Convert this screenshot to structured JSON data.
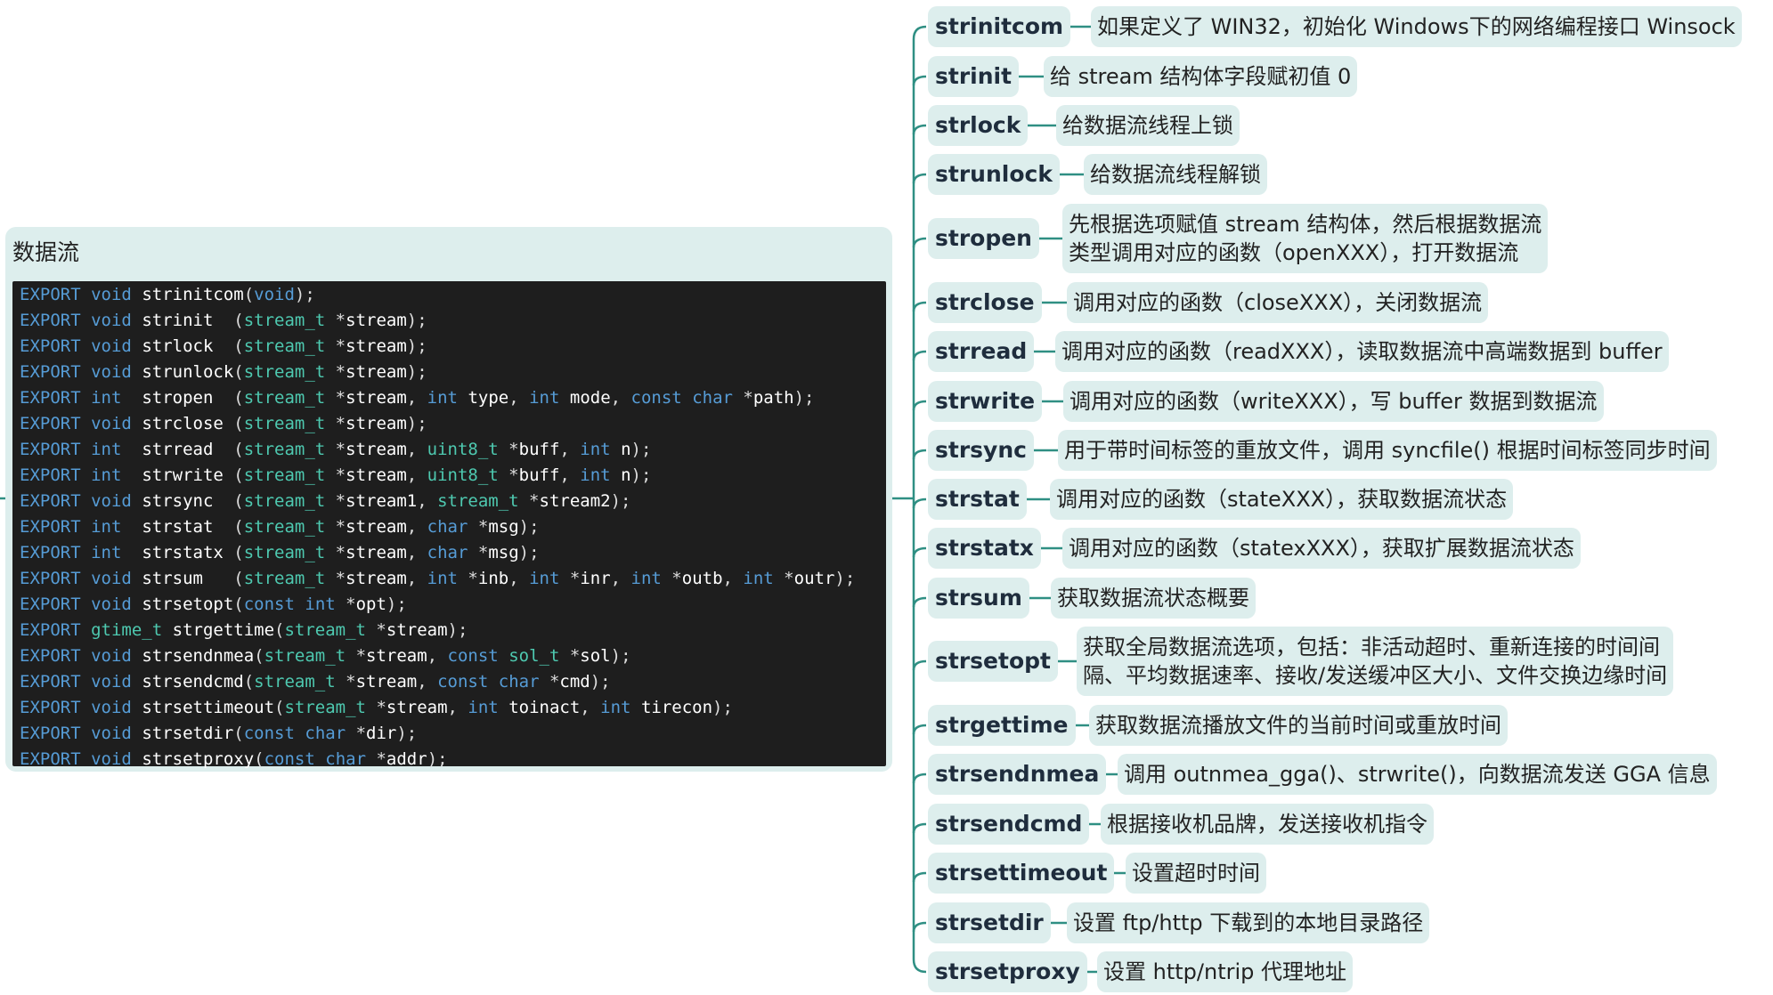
{
  "panel": {
    "title": "数据流"
  },
  "code_lines": [
    [
      [
        "kw",
        "EXPORT"
      ],
      [
        "pu",
        " "
      ],
      [
        "kw",
        "void"
      ],
      [
        "pu",
        " "
      ],
      [
        "fn",
        "strinitcom"
      ],
      [
        "pu",
        "("
      ],
      [
        "kw",
        "void"
      ],
      [
        "pu",
        ");"
      ]
    ],
    [
      [
        "kw",
        "EXPORT"
      ],
      [
        "pu",
        " "
      ],
      [
        "kw",
        "void"
      ],
      [
        "pu",
        " "
      ],
      [
        "fn",
        "strinit  "
      ],
      [
        "pu",
        "("
      ],
      [
        "ty",
        "stream_t"
      ],
      [
        "pu",
        " *"
      ],
      [
        "pm",
        "stream"
      ],
      [
        "pu",
        ");"
      ]
    ],
    [
      [
        "kw",
        "EXPORT"
      ],
      [
        "pu",
        " "
      ],
      [
        "kw",
        "void"
      ],
      [
        "pu",
        " "
      ],
      [
        "fn",
        "strlock  "
      ],
      [
        "pu",
        "("
      ],
      [
        "ty",
        "stream_t"
      ],
      [
        "pu",
        " *"
      ],
      [
        "pm",
        "stream"
      ],
      [
        "pu",
        ");"
      ]
    ],
    [
      [
        "kw",
        "EXPORT"
      ],
      [
        "pu",
        " "
      ],
      [
        "kw",
        "void"
      ],
      [
        "pu",
        " "
      ],
      [
        "fn",
        "strunlock"
      ],
      [
        "pu",
        "("
      ],
      [
        "ty",
        "stream_t"
      ],
      [
        "pu",
        " *"
      ],
      [
        "pm",
        "stream"
      ],
      [
        "pu",
        ");"
      ]
    ],
    [
      [
        "kw",
        "EXPORT"
      ],
      [
        "pu",
        " "
      ],
      [
        "kw",
        "int "
      ],
      [
        "pu",
        " "
      ],
      [
        "fn",
        "stropen  "
      ],
      [
        "pu",
        "("
      ],
      [
        "ty",
        "stream_t"
      ],
      [
        "pu",
        " *"
      ],
      [
        "pm",
        "stream"
      ],
      [
        "pu",
        ", "
      ],
      [
        "kw",
        "int"
      ],
      [
        "pu",
        " "
      ],
      [
        "pm",
        "type"
      ],
      [
        "pu",
        ", "
      ],
      [
        "kw",
        "int"
      ],
      [
        "pu",
        " "
      ],
      [
        "pm",
        "mode"
      ],
      [
        "pu",
        ", "
      ],
      [
        "kw",
        "const"
      ],
      [
        "pu",
        " "
      ],
      [
        "kw",
        "char"
      ],
      [
        "pu",
        " *"
      ],
      [
        "pm",
        "path"
      ],
      [
        "pu",
        ");"
      ]
    ],
    [
      [
        "kw",
        "EXPORT"
      ],
      [
        "pu",
        " "
      ],
      [
        "kw",
        "void"
      ],
      [
        "pu",
        " "
      ],
      [
        "fn",
        "strclose "
      ],
      [
        "pu",
        "("
      ],
      [
        "ty",
        "stream_t"
      ],
      [
        "pu",
        " *"
      ],
      [
        "pm",
        "stream"
      ],
      [
        "pu",
        ");"
      ]
    ],
    [
      [
        "kw",
        "EXPORT"
      ],
      [
        "pu",
        " "
      ],
      [
        "kw",
        "int "
      ],
      [
        "pu",
        " "
      ],
      [
        "fn",
        "strread  "
      ],
      [
        "pu",
        "("
      ],
      [
        "ty",
        "stream_t"
      ],
      [
        "pu",
        " *"
      ],
      [
        "pm",
        "stream"
      ],
      [
        "pu",
        ", "
      ],
      [
        "ty",
        "uint8_t"
      ],
      [
        "pu",
        " *"
      ],
      [
        "pm",
        "buff"
      ],
      [
        "pu",
        ", "
      ],
      [
        "kw",
        "int"
      ],
      [
        "pu",
        " "
      ],
      [
        "pm",
        "n"
      ],
      [
        "pu",
        ");"
      ]
    ],
    [
      [
        "kw",
        "EXPORT"
      ],
      [
        "pu",
        " "
      ],
      [
        "kw",
        "int "
      ],
      [
        "pu",
        " "
      ],
      [
        "fn",
        "strwrite "
      ],
      [
        "pu",
        "("
      ],
      [
        "ty",
        "stream_t"
      ],
      [
        "pu",
        " *"
      ],
      [
        "pm",
        "stream"
      ],
      [
        "pu",
        ", "
      ],
      [
        "ty",
        "uint8_t"
      ],
      [
        "pu",
        " *"
      ],
      [
        "pm",
        "buff"
      ],
      [
        "pu",
        ", "
      ],
      [
        "kw",
        "int"
      ],
      [
        "pu",
        " "
      ],
      [
        "pm",
        "n"
      ],
      [
        "pu",
        ");"
      ]
    ],
    [
      [
        "kw",
        "EXPORT"
      ],
      [
        "pu",
        " "
      ],
      [
        "kw",
        "void"
      ],
      [
        "pu",
        " "
      ],
      [
        "fn",
        "strsync  "
      ],
      [
        "pu",
        "("
      ],
      [
        "ty",
        "stream_t"
      ],
      [
        "pu",
        " *"
      ],
      [
        "pm",
        "stream1"
      ],
      [
        "pu",
        ", "
      ],
      [
        "ty",
        "stream_t"
      ],
      [
        "pu",
        " *"
      ],
      [
        "pm",
        "stream2"
      ],
      [
        "pu",
        ");"
      ]
    ],
    [
      [
        "kw",
        "EXPORT"
      ],
      [
        "pu",
        " "
      ],
      [
        "kw",
        "int "
      ],
      [
        "pu",
        " "
      ],
      [
        "fn",
        "strstat  "
      ],
      [
        "pu",
        "("
      ],
      [
        "ty",
        "stream_t"
      ],
      [
        "pu",
        " *"
      ],
      [
        "pm",
        "stream"
      ],
      [
        "pu",
        ", "
      ],
      [
        "kw",
        "char"
      ],
      [
        "pu",
        " *"
      ],
      [
        "pm",
        "msg"
      ],
      [
        "pu",
        ");"
      ]
    ],
    [
      [
        "kw",
        "EXPORT"
      ],
      [
        "pu",
        " "
      ],
      [
        "kw",
        "int "
      ],
      [
        "pu",
        " "
      ],
      [
        "fn",
        "strstatx "
      ],
      [
        "pu",
        "("
      ],
      [
        "ty",
        "stream_t"
      ],
      [
        "pu",
        " *"
      ],
      [
        "pm",
        "stream"
      ],
      [
        "pu",
        ", "
      ],
      [
        "kw",
        "char"
      ],
      [
        "pu",
        " *"
      ],
      [
        "pm",
        "msg"
      ],
      [
        "pu",
        ");"
      ]
    ],
    [
      [
        "kw",
        "EXPORT"
      ],
      [
        "pu",
        " "
      ],
      [
        "kw",
        "void"
      ],
      [
        "pu",
        " "
      ],
      [
        "fn",
        "strsum   "
      ],
      [
        "pu",
        "("
      ],
      [
        "ty",
        "stream_t"
      ],
      [
        "pu",
        " *"
      ],
      [
        "pm",
        "stream"
      ],
      [
        "pu",
        ", "
      ],
      [
        "kw",
        "int"
      ],
      [
        "pu",
        " *"
      ],
      [
        "pm",
        "inb"
      ],
      [
        "pu",
        ", "
      ],
      [
        "kw",
        "int"
      ],
      [
        "pu",
        " *"
      ],
      [
        "pm",
        "inr"
      ],
      [
        "pu",
        ", "
      ],
      [
        "kw",
        "int"
      ],
      [
        "pu",
        " *"
      ],
      [
        "pm",
        "outb"
      ],
      [
        "pu",
        ", "
      ],
      [
        "kw",
        "int"
      ],
      [
        "pu",
        " *"
      ],
      [
        "pm",
        "outr"
      ],
      [
        "pu",
        ");"
      ]
    ],
    [
      [
        "kw",
        "EXPORT"
      ],
      [
        "pu",
        " "
      ],
      [
        "kw",
        "void"
      ],
      [
        "pu",
        " "
      ],
      [
        "fn",
        "strsetopt"
      ],
      [
        "pu",
        "("
      ],
      [
        "kw",
        "const"
      ],
      [
        "pu",
        " "
      ],
      [
        "kw",
        "int"
      ],
      [
        "pu",
        " *"
      ],
      [
        "pm",
        "opt"
      ],
      [
        "pu",
        ");"
      ]
    ],
    [
      [
        "kw",
        "EXPORT"
      ],
      [
        "pu",
        " "
      ],
      [
        "ty",
        "gtime_t"
      ],
      [
        "pu",
        " "
      ],
      [
        "fn",
        "strgettime"
      ],
      [
        "pu",
        "("
      ],
      [
        "ty",
        "stream_t"
      ],
      [
        "pu",
        " *"
      ],
      [
        "pm",
        "stream"
      ],
      [
        "pu",
        ");"
      ]
    ],
    [
      [
        "kw",
        "EXPORT"
      ],
      [
        "pu",
        " "
      ],
      [
        "kw",
        "void"
      ],
      [
        "pu",
        " "
      ],
      [
        "fn",
        "strsendnmea"
      ],
      [
        "pu",
        "("
      ],
      [
        "ty",
        "stream_t"
      ],
      [
        "pu",
        " *"
      ],
      [
        "pm",
        "stream"
      ],
      [
        "pu",
        ", "
      ],
      [
        "kw",
        "const"
      ],
      [
        "pu",
        " "
      ],
      [
        "ty",
        "sol_t"
      ],
      [
        "pu",
        " *"
      ],
      [
        "pm",
        "sol"
      ],
      [
        "pu",
        ");"
      ]
    ],
    [
      [
        "kw",
        "EXPORT"
      ],
      [
        "pu",
        " "
      ],
      [
        "kw",
        "void"
      ],
      [
        "pu",
        " "
      ],
      [
        "fn",
        "strsendcmd"
      ],
      [
        "pu",
        "("
      ],
      [
        "ty",
        "stream_t"
      ],
      [
        "pu",
        " *"
      ],
      [
        "pm",
        "stream"
      ],
      [
        "pu",
        ", "
      ],
      [
        "kw",
        "const"
      ],
      [
        "pu",
        " "
      ],
      [
        "kw",
        "char"
      ],
      [
        "pu",
        " *"
      ],
      [
        "pm",
        "cmd"
      ],
      [
        "pu",
        ");"
      ]
    ],
    [
      [
        "kw",
        "EXPORT"
      ],
      [
        "pu",
        " "
      ],
      [
        "kw",
        "void"
      ],
      [
        "pu",
        " "
      ],
      [
        "fn",
        "strsettimeout"
      ],
      [
        "pu",
        "("
      ],
      [
        "ty",
        "stream_t"
      ],
      [
        "pu",
        " *"
      ],
      [
        "pm",
        "stream"
      ],
      [
        "pu",
        ", "
      ],
      [
        "kw",
        "int"
      ],
      [
        "pu",
        " "
      ],
      [
        "pm",
        "toinact"
      ],
      [
        "pu",
        ", "
      ],
      [
        "kw",
        "int"
      ],
      [
        "pu",
        " "
      ],
      [
        "pm",
        "tirecon"
      ],
      [
        "pu",
        ");"
      ]
    ],
    [
      [
        "kw",
        "EXPORT"
      ],
      [
        "pu",
        " "
      ],
      [
        "kw",
        "void"
      ],
      [
        "pu",
        " "
      ],
      [
        "fn",
        "strsetdir"
      ],
      [
        "pu",
        "("
      ],
      [
        "kw",
        "const"
      ],
      [
        "pu",
        " "
      ],
      [
        "kw",
        "char"
      ],
      [
        "pu",
        " *"
      ],
      [
        "pm",
        "dir"
      ],
      [
        "pu",
        ");"
      ]
    ],
    [
      [
        "kw",
        "EXPORT"
      ],
      [
        "pu",
        " "
      ],
      [
        "kw",
        "void"
      ],
      [
        "pu",
        " "
      ],
      [
        "fn",
        "strsetproxy"
      ],
      [
        "pu",
        "("
      ],
      [
        "kw",
        "const"
      ],
      [
        "pu",
        " "
      ],
      [
        "kw",
        "char"
      ],
      [
        "pu",
        " *"
      ],
      [
        "pm",
        "addr"
      ],
      [
        "pu",
        ");"
      ]
    ]
  ],
  "nodes": [
    {
      "name": "strinitcom",
      "desc": [
        "如果定义了 WIN32，初始化 Windows下的网络编程接口 Winsock"
      ]
    },
    {
      "name": "strinit",
      "desc": [
        "给 stream 结构体字段赋初值 0"
      ]
    },
    {
      "name": "strlock",
      "desc": [
        "给数据流线程上锁"
      ]
    },
    {
      "name": "strunlock",
      "desc": [
        "给数据流线程解锁"
      ]
    },
    {
      "name": "stropen",
      "desc": [
        "先根据选项赋值 stream 结构体，然后根据数据流",
        "类型调用对应的函数（openXXX），打开数据流"
      ]
    },
    {
      "name": "strclose",
      "desc": [
        "调用对应的函数（closeXXX），关闭数据流"
      ]
    },
    {
      "name": "strread",
      "desc": [
        "调用对应的函数（readXXX），读取数据流中高端数据到 buffer"
      ]
    },
    {
      "name": "strwrite",
      "desc": [
        "调用对应的函数（writeXXX），写 buffer 数据到数据流"
      ]
    },
    {
      "name": "strsync",
      "desc": [
        "用于带时间标签的重放文件，调用 syncfile() 根据时间标签同步时间"
      ]
    },
    {
      "name": "strstat",
      "desc": [
        "调用对应的函数（stateXXX），获取数据流状态"
      ]
    },
    {
      "name": "strstatx",
      "desc": [
        "调用对应的函数（statexXXX），获取扩展数据流状态"
      ]
    },
    {
      "name": "strsum",
      "desc": [
        "获取数据流状态概要"
      ]
    },
    {
      "name": "strsetopt",
      "desc": [
        "获取全局数据流选项，包括：非活动超时、重新连接的时间间",
        "隔、平均数据速率、接收/发送缓冲区大小、文件交换边缘时间"
      ]
    },
    {
      "name": "strgettime",
      "desc": [
        "获取数据流播放文件的当前时间或重放时间"
      ]
    },
    {
      "name": "strsendnmea",
      "desc": [
        "调用 outnmea_gga()、strwrite()，向数据流发送 GGA 信息"
      ]
    },
    {
      "name": "strsendcmd",
      "desc": [
        "根据接收机品牌，发送接收机指令"
      ]
    },
    {
      "name": "strsettimeout",
      "desc": [
        "设置超时时间"
      ]
    },
    {
      "name": "strsetdir",
      "desc": [
        "设置 ftp/http 下载到的本地目录路径"
      ]
    },
    {
      "name": "strsetproxy",
      "desc": [
        "设置 http/ntrip 代理地址"
      ]
    }
  ]
}
